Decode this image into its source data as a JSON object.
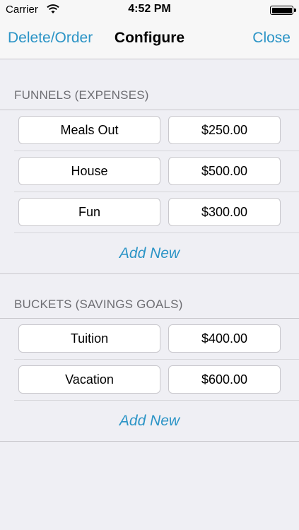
{
  "status_bar": {
    "carrier": "Carrier",
    "time": "4:52 PM"
  },
  "nav": {
    "left_label": "Delete/Order",
    "title": "Configure",
    "right_label": "Close"
  },
  "funnels": {
    "header": "FUNNELS (EXPENSES)",
    "rows": [
      {
        "name": "Meals Out",
        "amount": "$250.00"
      },
      {
        "name": "House",
        "amount": "$500.00"
      },
      {
        "name": "Fun",
        "amount": "$300.00"
      }
    ],
    "add_label": "Add New"
  },
  "buckets": {
    "header": "BUCKETS (SAVINGS GOALS)",
    "rows": [
      {
        "name": "Tuition",
        "amount": "$400.00"
      },
      {
        "name": "Vacation",
        "amount": "$600.00"
      }
    ],
    "add_label": "Add New"
  },
  "colors": {
    "accent": "#2b94c6",
    "background": "#efeff4",
    "header_text": "#6d6d72"
  }
}
